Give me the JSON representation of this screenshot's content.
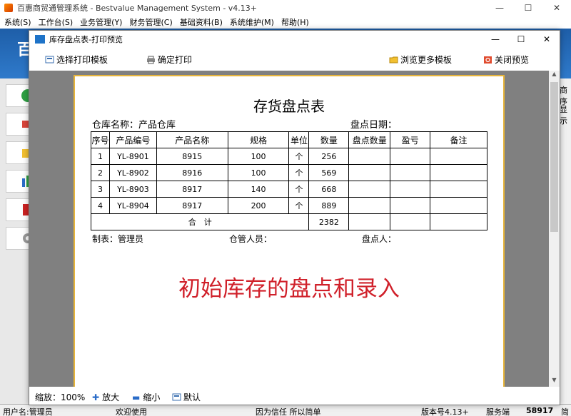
{
  "main": {
    "title": "百惠商贸通管理系统 - Bestvalue Management System - v4.13+",
    "menu": [
      "系统(S)",
      "工作台(S)",
      "业务管理(Y)",
      "财务管理(C)",
      "基础资料(B)",
      "系统维护(M)",
      "帮助(H)"
    ],
    "banner_text": "百",
    "right_strip": [
      "商序",
      "显示"
    ],
    "status": {
      "user": "用户名:管理员",
      "welcome": "欢迎使用",
      "slogan": "因为信任 所以简单",
      "version": "版本号4.13+",
      "server": "服务端",
      "number": "58917",
      "tail": "简"
    }
  },
  "dialog": {
    "title": "库存盘点表-打印预览",
    "toolbar": {
      "select_template": "选择打印模板",
      "confirm_print": "确定打印",
      "browse_templates": "浏览更多模板",
      "close_preview": "关闭预览"
    },
    "bottom": {
      "zoom_label": "缩放：100%",
      "zoom_in": "放大",
      "zoom_out": "缩小",
      "default": "默认"
    }
  },
  "document": {
    "title": "存货盘点表",
    "warehouse_label": "仓库名称：产品仓库",
    "date_label": "盘点日期：",
    "headers": [
      "序号",
      "产品编号",
      "产品名称",
      "规格",
      "单位",
      "数量",
      "盘点数量",
      "盈亏",
      "备注"
    ],
    "rows": [
      [
        "1",
        "YL-8901",
        "8915",
        "100",
        "个",
        "256",
        "",
        "",
        ""
      ],
      [
        "2",
        "YL-8902",
        "8916",
        "100",
        "个",
        "569",
        "",
        "",
        ""
      ],
      [
        "3",
        "YL-8903",
        "8917",
        "140",
        "个",
        "668",
        "",
        "",
        ""
      ],
      [
        "4",
        "YL-8904",
        "8917",
        "200",
        "个",
        "889",
        "",
        "",
        ""
      ]
    ],
    "total_label": "合　计",
    "total_value": "2382",
    "maker": "制表：管理员",
    "keeper": "仓管人员：",
    "counter": "盘点人：",
    "watermark": "初始库存的盘点和录入"
  },
  "colors": {
    "accent_blue": "#1e5ea8",
    "watermark_red": "#d0202a",
    "paper_border": "#e6b43a"
  }
}
